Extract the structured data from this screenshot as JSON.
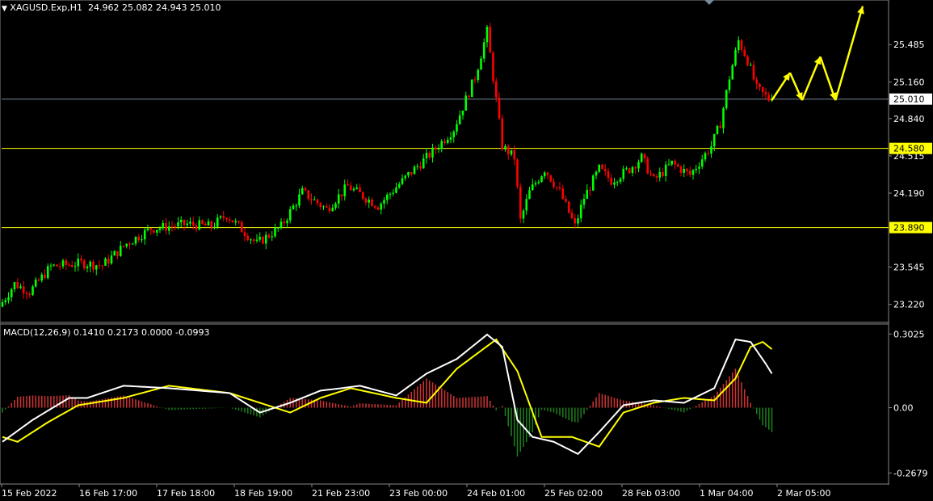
{
  "header": {
    "symbol": "XAGUSD.Exp,H1",
    "ohlc": "24.962 25.082 24.943 25.010"
  },
  "macd_header": "MACD(12,26,9) 0.1410 0.2173 0.0000 -0.0993",
  "colors": {
    "background": "#000000",
    "bull": "#00ff00",
    "bear": "#ff0000",
    "level_line": "#ffff00",
    "price_line": "#778899",
    "arrow": "#ffff00",
    "macd_line": "#ffffff",
    "signal_line": "#ffff00",
    "hist_pos": "#c83232",
    "hist_neg": "#1e7a1e",
    "axis_text": "#ffffff"
  },
  "chart_data": [
    {
      "type": "candlestick",
      "symbol": "XAGUSD.Exp",
      "timeframe": "H1",
      "y_ticks": [
        "25.485",
        "25.160",
        "24.840",
        "24.515",
        "24.190",
        "23.545",
        "23.220"
      ],
      "ylim": [
        23.07,
        25.86
      ],
      "x_tick_labels": [
        "15 Feb 2022",
        "16 Feb 17:00",
        "17 Feb 18:00",
        "18 Feb 19:00",
        "21 Feb 23:00",
        "23 Feb 00:00",
        "24 Feb 01:00",
        "25 Feb 02:00",
        "28 Feb 03:00",
        "1 Mar 04:00",
        "2 Mar 05:00"
      ],
      "horizontal_levels": [
        {
          "value": 24.58,
          "label": "24.580"
        },
        {
          "value": 23.89,
          "label": "23.890"
        }
      ],
      "current_price": {
        "value": 25.01,
        "label": "25.010"
      },
      "anchors": [
        {
          "bar": 0,
          "price": 23.2
        },
        {
          "bar": 5,
          "price": 23.4
        },
        {
          "bar": 10,
          "price": 23.33
        },
        {
          "bar": 17,
          "price": 23.55
        },
        {
          "bar": 27,
          "price": 23.58
        },
        {
          "bar": 34,
          "price": 23.56
        },
        {
          "bar": 42,
          "price": 23.75
        },
        {
          "bar": 50,
          "price": 23.88
        },
        {
          "bar": 62,
          "price": 23.92
        },
        {
          "bar": 70,
          "price": 23.9
        },
        {
          "bar": 75,
          "price": 24.0
        },
        {
          "bar": 85,
          "price": 23.75
        },
        {
          "bar": 93,
          "price": 23.9
        },
        {
          "bar": 100,
          "price": 24.2
        },
        {
          "bar": 108,
          "price": 24.05
        },
        {
          "bar": 115,
          "price": 24.25
        },
        {
          "bar": 125,
          "price": 24.08
        },
        {
          "bar": 135,
          "price": 24.35
        },
        {
          "bar": 143,
          "price": 24.55
        },
        {
          "bar": 150,
          "price": 24.75
        },
        {
          "bar": 157,
          "price": 25.2
        },
        {
          "bar": 161,
          "price": 25.6
        },
        {
          "bar": 163,
          "price": 25.2
        },
        {
          "bar": 166,
          "price": 24.6
        },
        {
          "bar": 170,
          "price": 24.5
        },
        {
          "bar": 172,
          "price": 23.95
        },
        {
          "bar": 175,
          "price": 24.2
        },
        {
          "bar": 180,
          "price": 24.4
        },
        {
          "bar": 185,
          "price": 24.2
        },
        {
          "bar": 190,
          "price": 23.9
        },
        {
          "bar": 193,
          "price": 24.15
        },
        {
          "bar": 198,
          "price": 24.4
        },
        {
          "bar": 202,
          "price": 24.3
        },
        {
          "bar": 208,
          "price": 24.4
        },
        {
          "bar": 212,
          "price": 24.5
        },
        {
          "bar": 216,
          "price": 24.3
        },
        {
          "bar": 222,
          "price": 24.45
        },
        {
          "bar": 228,
          "price": 24.35
        },
        {
          "bar": 235,
          "price": 24.6
        },
        {
          "bar": 238,
          "price": 24.8
        },
        {
          "bar": 241,
          "price": 25.2
        },
        {
          "bar": 244,
          "price": 25.52
        },
        {
          "bar": 247,
          "price": 25.35
        },
        {
          "bar": 250,
          "price": 25.1
        },
        {
          "bar": 254,
          "price": 25.01
        }
      ],
      "projection_arrows": [
        [
          {
            "bar": 254,
            "price": 25.0
          },
          {
            "bar": 260,
            "price": 25.24
          }
        ],
        [
          {
            "bar": 260,
            "price": 25.24
          },
          {
            "bar": 264,
            "price": 25.0
          }
        ],
        [
          {
            "bar": 264,
            "price": 25.0
          },
          {
            "bar": 270,
            "price": 25.38
          }
        ],
        [
          {
            "bar": 270,
            "price": 25.38
          },
          {
            "bar": 275,
            "price": 25.0
          }
        ],
        [
          {
            "bar": 275,
            "price": 25.0
          },
          {
            "bar": 284,
            "price": 25.82
          }
        ]
      ]
    },
    {
      "type": "macd",
      "params": "12,26,9",
      "values": {
        "macd": 0.141,
        "signal": 0.2173,
        "zero": 0.0,
        "histogram": -0.0993
      },
      "y_ticks": [
        "0.3025",
        "0.00",
        "-0.2679"
      ],
      "ylim": [
        -0.31,
        0.34
      ],
      "macd_anchors": [
        {
          "bar": 0,
          "v": -0.14
        },
        {
          "bar": 10,
          "v": -0.05
        },
        {
          "bar": 22,
          "v": 0.04
        },
        {
          "bar": 28,
          "v": 0.04
        },
        {
          "bar": 40,
          "v": 0.09
        },
        {
          "bar": 55,
          "v": 0.08
        },
        {
          "bar": 75,
          "v": 0.06
        },
        {
          "bar": 85,
          "v": -0.02
        },
        {
          "bar": 95,
          "v": 0.02
        },
        {
          "bar": 105,
          "v": 0.07
        },
        {
          "bar": 112,
          "v": 0.08
        },
        {
          "bar": 118,
          "v": 0.09
        },
        {
          "bar": 130,
          "v": 0.05
        },
        {
          "bar": 140,
          "v": 0.14
        },
        {
          "bar": 150,
          "v": 0.2
        },
        {
          "bar": 160,
          "v": 0.3
        },
        {
          "bar": 165,
          "v": 0.25
        },
        {
          "bar": 170,
          "v": -0.05
        },
        {
          "bar": 175,
          "v": -0.12
        },
        {
          "bar": 182,
          "v": -0.14
        },
        {
          "bar": 190,
          "v": -0.19
        },
        {
          "bar": 197,
          "v": -0.1
        },
        {
          "bar": 205,
          "v": 0.01
        },
        {
          "bar": 215,
          "v": 0.03
        },
        {
          "bar": 225,
          "v": 0.02
        },
        {
          "bar": 235,
          "v": 0.08
        },
        {
          "bar": 242,
          "v": 0.28
        },
        {
          "bar": 247,
          "v": 0.27
        },
        {
          "bar": 252,
          "v": 0.18
        },
        {
          "bar": 254,
          "v": 0.14
        }
      ],
      "signal_anchors": [
        {
          "bar": 0,
          "v": -0.12
        },
        {
          "bar": 5,
          "v": -0.14
        },
        {
          "bar": 15,
          "v": -0.06
        },
        {
          "bar": 25,
          "v": 0.01
        },
        {
          "bar": 40,
          "v": 0.04
        },
        {
          "bar": 55,
          "v": 0.09
        },
        {
          "bar": 75,
          "v": 0.06
        },
        {
          "bar": 85,
          "v": 0.02
        },
        {
          "bar": 95,
          "v": -0.02
        },
        {
          "bar": 105,
          "v": 0.04
        },
        {
          "bar": 115,
          "v": 0.08
        },
        {
          "bar": 130,
          "v": 0.04
        },
        {
          "bar": 140,
          "v": 0.02
        },
        {
          "bar": 150,
          "v": 0.16
        },
        {
          "bar": 163,
          "v": 0.28
        },
        {
          "bar": 170,
          "v": 0.15
        },
        {
          "bar": 178,
          "v": -0.12
        },
        {
          "bar": 188,
          "v": -0.12
        },
        {
          "bar": 197,
          "v": -0.16
        },
        {
          "bar": 205,
          "v": -0.02
        },
        {
          "bar": 215,
          "v": 0.02
        },
        {
          "bar": 225,
          "v": 0.04
        },
        {
          "bar": 235,
          "v": 0.03
        },
        {
          "bar": 242,
          "v": 0.12
        },
        {
          "bar": 247,
          "v": 0.25
        },
        {
          "bar": 251,
          "v": 0.27
        },
        {
          "bar": 254,
          "v": 0.24
        }
      ]
    }
  ]
}
